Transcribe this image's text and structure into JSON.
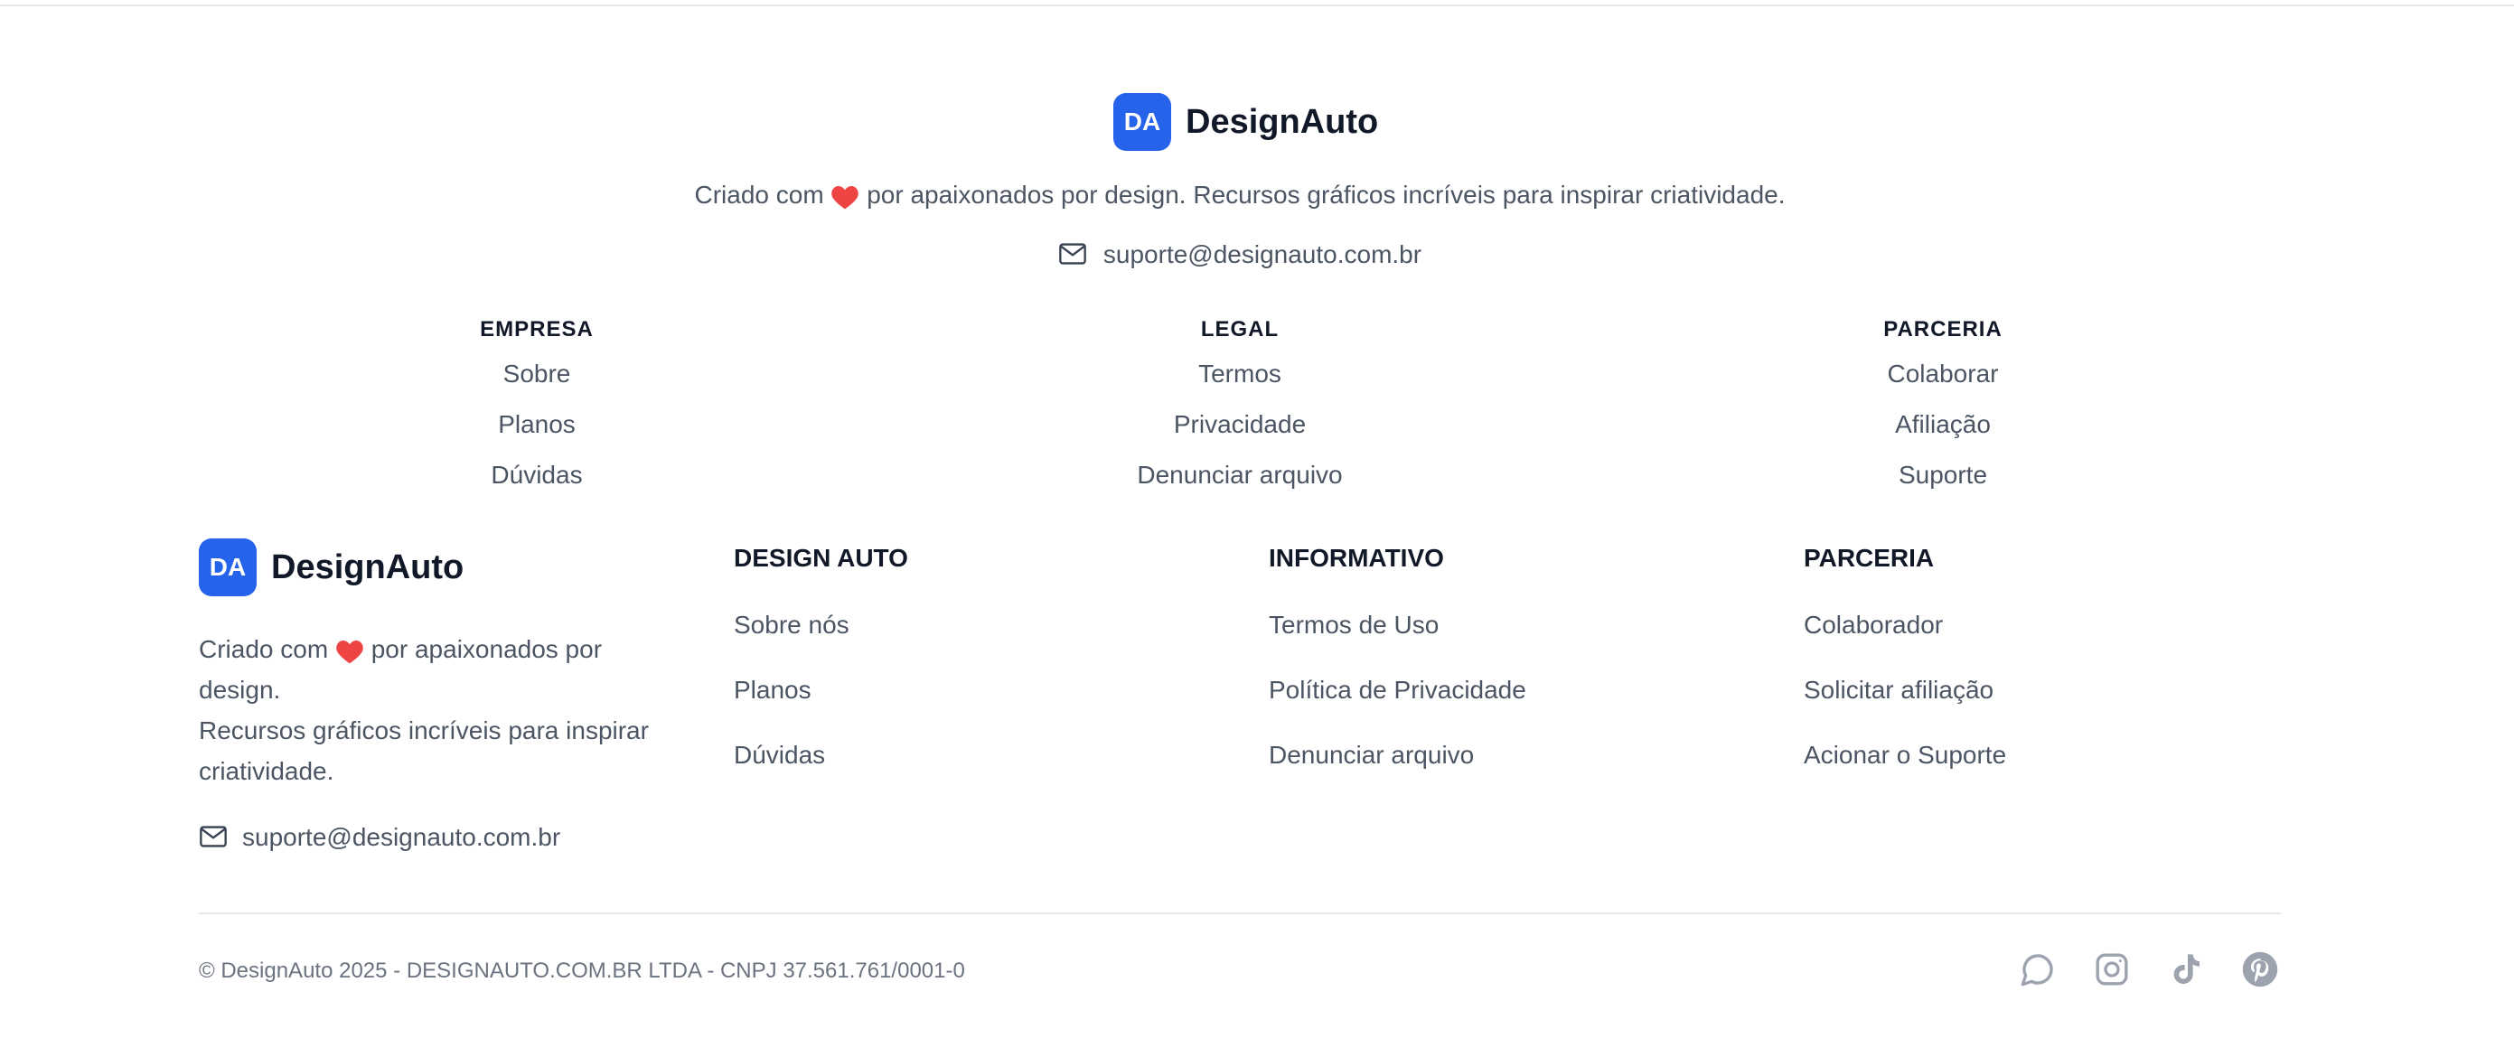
{
  "brand": {
    "logo_initials": "DA",
    "name": "DesignAuto",
    "accent_color": "#2563eb",
    "heart_color": "#ef4444"
  },
  "centered": {
    "tagline_before": "Criado com",
    "tagline_after": "por apaixonados por design. Recursos gráficos incríveis para inspirar criatividade.",
    "email": "suporte@designauto.com.br",
    "columns": [
      {
        "title": "EMPRESA",
        "links": [
          "Sobre",
          "Planos",
          "Dúvidas"
        ]
      },
      {
        "title": "LEGAL",
        "links": [
          "Termos",
          "Privacidade",
          "Denunciar arquivo"
        ]
      },
      {
        "title": "PARCERIA",
        "links": [
          "Colaborar",
          "Afiliação",
          "Suporte"
        ]
      }
    ]
  },
  "footer": {
    "desc_before": "Criado com",
    "desc_after_line1": "por apaixonados por",
    "desc_line2": "design.",
    "desc_line3": "Recursos gráficos incríveis para inspirar",
    "desc_line4": "criatividade.",
    "email": "suporte@designauto.com.br",
    "columns": [
      {
        "title": "DESIGN AUTO",
        "links": [
          "Sobre nós",
          "Planos",
          "Dúvidas"
        ]
      },
      {
        "title": "INFORMATIVO",
        "links": [
          "Termos de Uso",
          "Política de Privacidade",
          "Denunciar arquivo"
        ]
      },
      {
        "title": "PARCERIA",
        "links": [
          "Colaborador",
          "Solicitar afiliação",
          "Acionar o Suporte"
        ]
      }
    ],
    "copyright": "© DesignAuto 2025 - DESIGNAUTO.COM.BR LTDA - CNPJ 37.561.761/0001-0",
    "socials": [
      "chat-icon",
      "instagram-icon",
      "tiktok-icon",
      "pinterest-icon"
    ]
  }
}
